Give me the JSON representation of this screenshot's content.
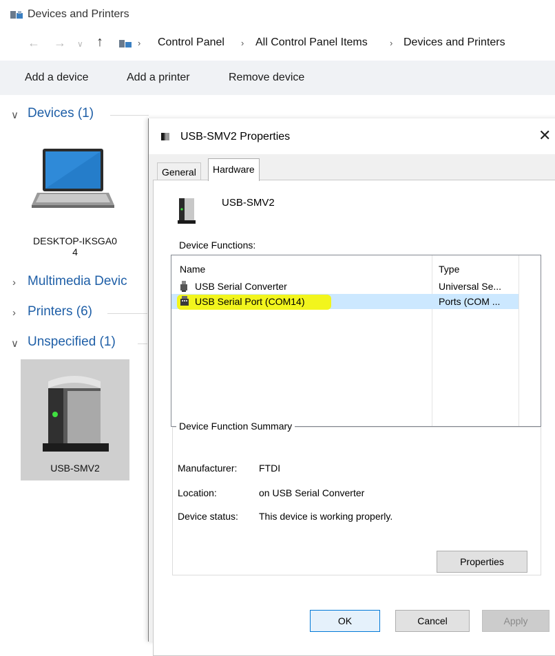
{
  "window": {
    "title": "Devices and Printers"
  },
  "breadcrumb": [
    "Control Panel",
    "All Control Panel Items",
    "Devices and Printers"
  ],
  "command_bar": {
    "add_device": "Add a device",
    "add_printer": "Add a printer",
    "remove_device": "Remove device"
  },
  "groups": {
    "devices": "Devices (1)",
    "multimedia": "Multimedia Devic",
    "printers": "Printers (6)",
    "unspecified": "Unspecified (1)"
  },
  "devices": {
    "computer_label_line1": "DESKTOP-IKSGA0",
    "computer_label_line2": "4",
    "usb_device_label": "USB-SMV2"
  },
  "dialog": {
    "title": "USB-SMV2 Properties",
    "close_glyph": "✕",
    "tabs": [
      "General",
      "Hardware"
    ],
    "device_name": "USB-SMV2",
    "device_functions_label": "Device Functions:",
    "columns": {
      "name": "Name",
      "type": "Type"
    },
    "rows": [
      {
        "name": "USB Serial Converter",
        "type": "Universal Se..."
      },
      {
        "name": "USB Serial Port (COM14)",
        "type": "Ports (COM ..."
      }
    ],
    "summary_title": "Device Function Summary",
    "summary": {
      "manufacturer_label": "Manufacturer:",
      "manufacturer": "FTDI",
      "location_label": "Location:",
      "location": "on USB Serial Converter",
      "status_label": "Device status:",
      "status": "This device is working properly."
    },
    "buttons": {
      "properties": "Properties",
      "ok": "OK",
      "cancel": "Cancel",
      "apply": "Apply"
    }
  },
  "colors": {
    "group_header": "#1f5fa7",
    "selected_row": "#cce8ff",
    "highlight": "#f5f50a"
  }
}
